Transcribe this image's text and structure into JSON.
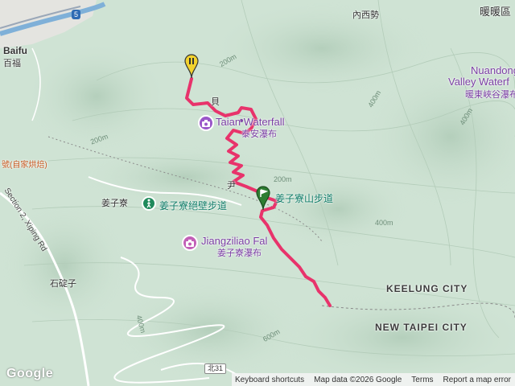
{
  "labels": {
    "baifu_en": "Baifu",
    "baifu_zh": "百福",
    "neixishi": "內西勢",
    "nuannuan": "暖暖區",
    "nuandong_1": "Nuandong",
    "nuandong_2": "Valley Waterf",
    "nuandong_zh": "暖東峽谷瀑布",
    "taian_en": "Taian Waterfall",
    "taian_zh": "泰安瀑布",
    "restaurant": "號(自家烘焙)",
    "jiangziliao": "姜子寮",
    "jiangziliao_trail_wall": "姜子寮絕壁步道",
    "jiangziliao_mtn_trail": "姜子寮山步道",
    "jiangziliao_falls_en": "Jiangziliao Fal",
    "jiangziliao_falls_zh": "姜子寮瀑布",
    "section2": "Section 2, Xiping Rd",
    "shidingzi": "石碇子",
    "keelung": "KEELUNG CITY",
    "new_taipei": "NEW TAIPEI CITY",
    "frag_1": "貝",
    "frag_2": "尹"
  },
  "contours": {
    "c1": "200m",
    "c2": "200m",
    "c3": "400m",
    "c4": "400m",
    "c5": "400m",
    "c6": "400m",
    "c7": "600m",
    "c8": "200m"
  },
  "roads": {
    "hwy5": "5",
    "bei31": "北31"
  },
  "footer": {
    "logo": "Google",
    "keyboard": "Keyboard shortcuts",
    "mapdata": "Map data ©2026 Google",
    "terms": "Terms",
    "report": "Report a map error"
  },
  "colors": {
    "route": "#e8336b",
    "terrain": "#cfe3d4",
    "start_pin": "#2e7d32",
    "end_pin": "#f2d22e",
    "poi_purple": "#7a3ea3"
  }
}
